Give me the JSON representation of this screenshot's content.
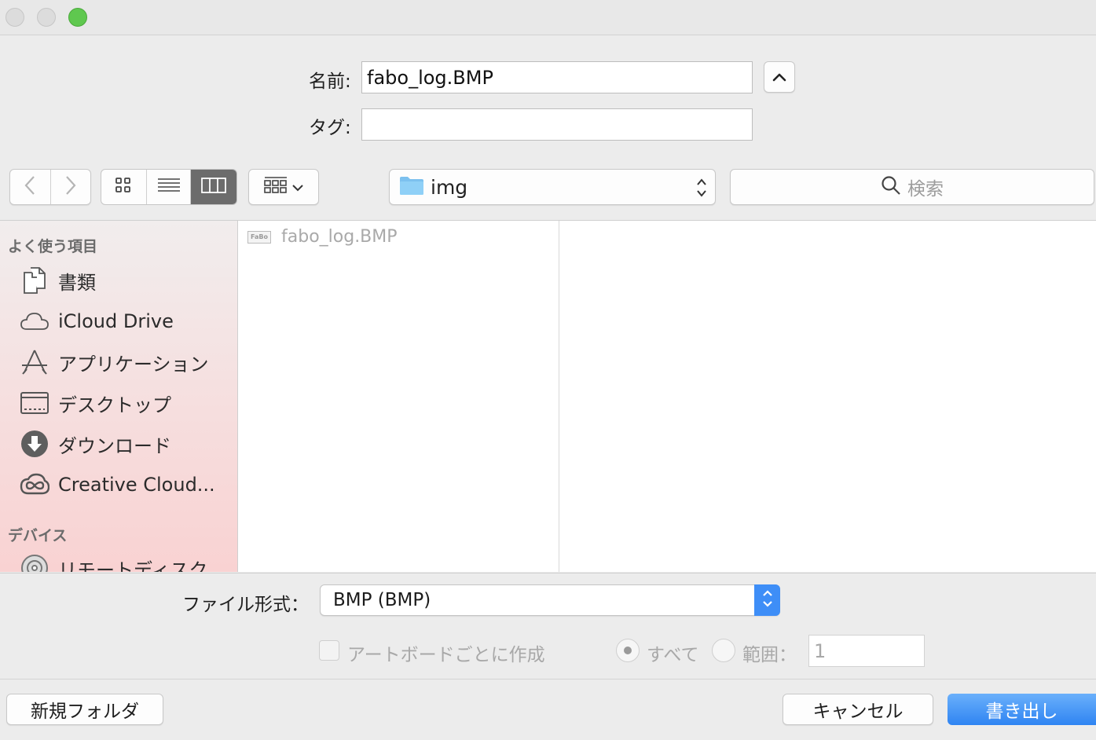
{
  "dialog": {
    "name_label": "名前:",
    "name_value": "fabo_log.BMP",
    "tags_label": "タグ:",
    "tags_value": ""
  },
  "toolbar": {
    "back_icon": "chevron-left-icon",
    "forward_icon": "chevron-right-icon",
    "view_modes": [
      "icon-view",
      "list-view",
      "column-view"
    ],
    "active_view": "column-view",
    "arrange_icon": "group-icon",
    "location": "img",
    "search_placeholder": "検索"
  },
  "sidebar": {
    "favorites_header": "よく使う項目",
    "items": [
      {
        "label": "書類",
        "icon": "document-icon"
      },
      {
        "label": "iCloud Drive",
        "icon": "cloud-icon"
      },
      {
        "label": "アプリケーション",
        "icon": "applications-icon"
      },
      {
        "label": "デスクトップ",
        "icon": "desktop-icon"
      },
      {
        "label": "ダウンロード",
        "icon": "download-icon"
      },
      {
        "label": "Creative Cloud...",
        "icon": "creative-cloud-icon"
      }
    ],
    "devices_header": "デバイス",
    "devices": [
      {
        "label": "リモートディスク",
        "icon": "remote-disc-icon"
      }
    ]
  },
  "files": [
    {
      "name": "fabo_log.BMP",
      "thumb_text": "FaBo"
    }
  ],
  "options": {
    "format_label": "ファイル形式：",
    "format_value": "BMP (BMP)",
    "artboards_label": "アートボードごとに作成",
    "all_label": "すべて",
    "range_label": "範囲：",
    "range_value": "1"
  },
  "footer": {
    "new_folder_label": "新規フォルダ",
    "cancel_label": "キャンセル",
    "export_label": "書き出し"
  },
  "colors": {
    "accent": "#3e8ef7",
    "zoom_button": "#5fc84f"
  }
}
